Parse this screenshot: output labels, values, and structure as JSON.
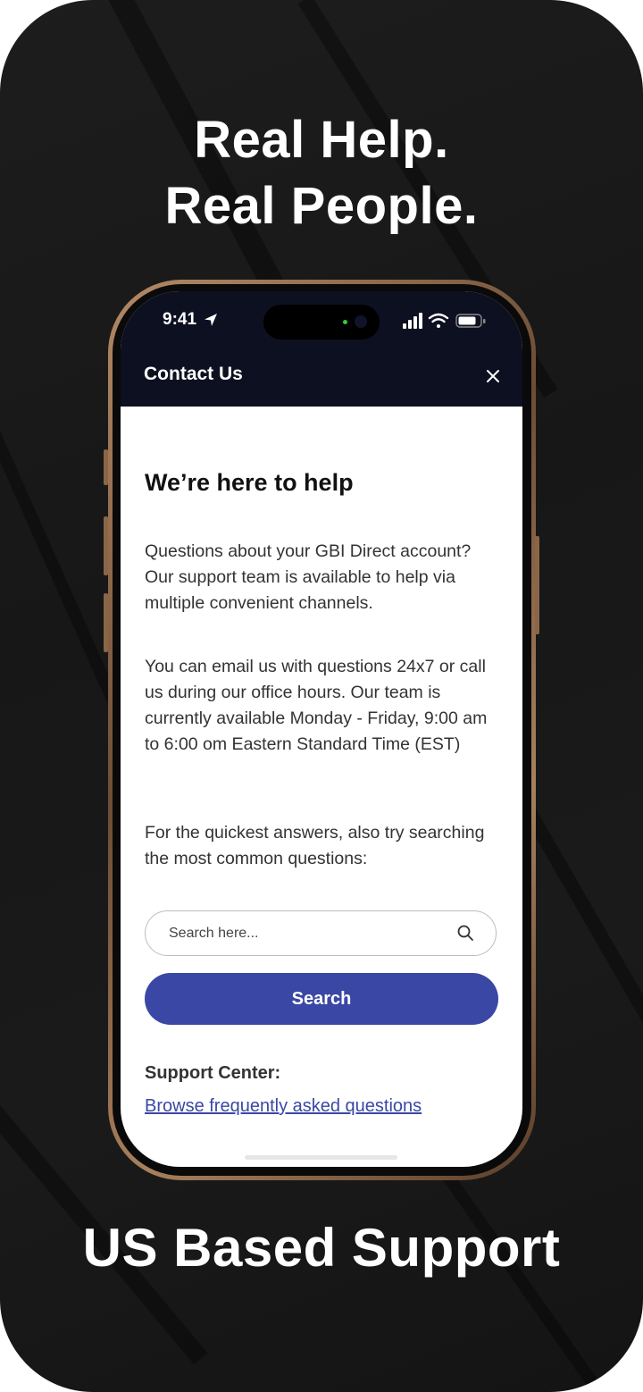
{
  "promo": {
    "headline_line1": "Real Help.",
    "headline_line2": "Real People.",
    "footer": "US Based Support"
  },
  "status_bar": {
    "time": "9:41"
  },
  "nav": {
    "title": "Contact Us"
  },
  "content": {
    "heading": "We’re here to help",
    "paragraph1": "Questions about your GBI Direct account? Our support team is available to help via multiple convenient channels.",
    "paragraph2": "You can email us with questions 24x7 or call us during our office hours. Our team is currently available Monday - Friday, 9:00 am to 6:00 om Eastern Standard Time (EST)",
    "paragraph3": "For the quickest answers, also try searching the most common questions:",
    "search_placeholder": "Search here...",
    "search_value": "",
    "search_button": "Search",
    "support_label": "Support Center:",
    "faq_link": "Browse frequently asked questions"
  },
  "colors": {
    "accent": "#3a47a5",
    "header_bg": "#0d1020",
    "background": "#1a1a1a"
  },
  "icons": {
    "location": "location-arrow-icon",
    "signal": "cellular-signal-icon",
    "wifi": "wifi-icon",
    "battery": "battery-icon",
    "close": "close-icon",
    "search": "search-icon"
  }
}
